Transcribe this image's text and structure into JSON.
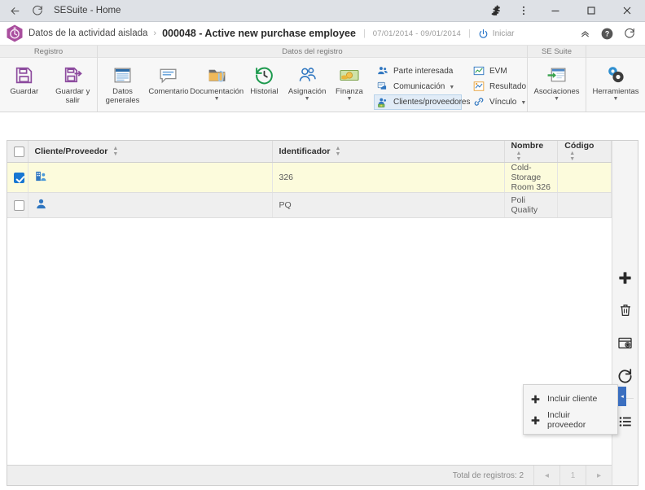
{
  "browser": {
    "back_icon": "back-arrow-icon",
    "reload_icon": "reload-icon",
    "title": "SESuite - Home",
    "extensions_icon": "puzzle-icon",
    "menu_icon": "kebab-menu-icon",
    "minimize_label": "–",
    "maximize_label": "□",
    "close_label": "✕"
  },
  "header": {
    "logo": "stopwatch-hexagon-logo",
    "breadcrumb_parent": "Datos de la actividad aislada",
    "breadcrumb_sep": "›",
    "breadcrumb_current": "000048 - Active new purchase employee",
    "divider": "|",
    "date_range": "07/01/2014 - 09/01/2014",
    "divider2": "|",
    "start_label": "Iniciar",
    "power_icon": "power-icon",
    "collapse_icon": "chevron-up-icon",
    "help_icon": "help-circle-icon",
    "refresh_icon": "refresh-icon"
  },
  "ribbon": {
    "groups": [
      {
        "title": "Registro"
      },
      {
        "title": "Datos del registro"
      },
      {
        "title": "SE Suite"
      },
      {
        "title": ""
      }
    ],
    "registro": [
      {
        "label": "Guardar",
        "icon": "save-icon",
        "caret": false
      },
      {
        "label": "Guardar y salir",
        "icon": "save-and-exit-icon",
        "caret": false
      }
    ],
    "datos": [
      {
        "label": "Datos generales",
        "icon": "general-data-icon",
        "caret": false
      },
      {
        "label": "Comentario",
        "icon": "comment-icon",
        "caret": false
      },
      {
        "label": "Documentación",
        "icon": "documentation-folder-icon",
        "caret": true
      },
      {
        "label": "Historial",
        "icon": "history-clock-icon",
        "caret": false
      },
      {
        "label": "Asignación",
        "icon": "assignment-users-icon",
        "caret": true
      },
      {
        "label": "Finanza",
        "icon": "finance-money-icon",
        "caret": true
      }
    ],
    "datos_small_col1": [
      {
        "label": "Parte interesada",
        "icon": "stakeholders-icon",
        "caret": false,
        "selected": false
      },
      {
        "label": "Comunicación",
        "icon": "communication-icon",
        "caret": true,
        "selected": false
      },
      {
        "label": "Clientes/proveedores",
        "icon": "clients-suppliers-icon",
        "caret": false,
        "selected": true
      }
    ],
    "datos_small_col2": [
      {
        "label": "EVM",
        "icon": "evm-chart-icon",
        "caret": false,
        "selected": false
      },
      {
        "label": "Resultado",
        "icon": "result-icon",
        "caret": false,
        "selected": false
      },
      {
        "label": "Vínculo",
        "icon": "link-icon",
        "caret": true,
        "selected": false
      }
    ],
    "sesuite": [
      {
        "label": "Asociaciones",
        "icon": "associations-icon",
        "caret": true
      }
    ],
    "tools": [
      {
        "label": "Herramientas",
        "icon": "tools-gears-icon",
        "caret": true
      }
    ]
  },
  "grid": {
    "columns": [
      {
        "label": "Cliente/Proveedor",
        "sortable": true
      },
      {
        "label": "Identificador",
        "sortable": true
      },
      {
        "label": "Nombre",
        "sortable": true
      },
      {
        "label": "Código",
        "sortable": true
      }
    ],
    "select_all_checkbox": false,
    "rows": [
      {
        "checked": true,
        "type_icon": "client-building-icon",
        "identificador": "326",
        "nombre": "Cold-Storage Room 326",
        "codigo": ""
      },
      {
        "checked": false,
        "type_icon": "supplier-person-icon",
        "identificador": "PQ",
        "nombre": "Poli Quality",
        "codigo": ""
      }
    ],
    "sidebar_buttons": [
      {
        "icon": "plus-icon",
        "name": "add-button"
      },
      {
        "icon": "trash-icon",
        "name": "delete-button"
      },
      {
        "icon": "preview-icon",
        "name": "preview-button"
      },
      {
        "icon": "refresh-icon",
        "name": "refresh-button"
      },
      {
        "icon": "list-icon",
        "name": "list-button"
      }
    ],
    "footer": {
      "total_label": "Total de registros: 2",
      "prev_label": "◂",
      "page_label": "1",
      "next_label": "▸"
    }
  },
  "context_menu": {
    "items": [
      {
        "label": "Incluir cliente",
        "icon": "plus-icon"
      },
      {
        "label": "Incluir proveedor",
        "icon": "plus-icon"
      }
    ]
  },
  "colors": {
    "accent_purple": "#8c4a9e",
    "accent_blue": "#1877d2",
    "row_selected": "#fcfbdc",
    "menu_anchor": "#3b6fc0"
  }
}
